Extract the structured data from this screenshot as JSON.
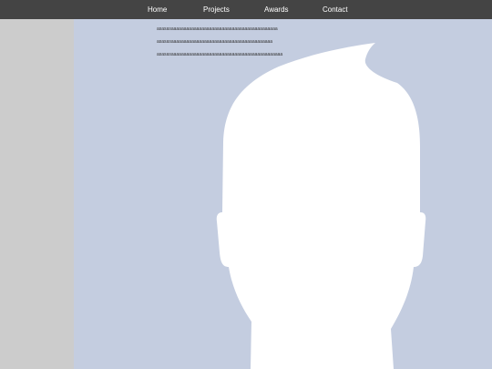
{
  "nav": {
    "items": [
      {
        "label": "Home"
      },
      {
        "label": "Projects"
      },
      {
        "label": "Awards"
      },
      {
        "label": "Contact"
      }
    ]
  },
  "main": {
    "text_lines": [
      "asasasaaaaaaaaaaaaaaaaaaaaaaaaaaaaaaaaaaaaaaaaaa",
      "asasasaaaaaaaaaaaaaaaaaaaaaaaaaaaaaaaaaaaaaaaa",
      "asasasaaaaaaaaaaaaaaaaaaaaaaaaaaaaaaaaaaaaaaaaaaaa"
    ],
    "avatar_icon": "default-profile-silhouette-icon"
  },
  "colors": {
    "nav_bg": "#444444",
    "sidebar_bg": "#cccccc",
    "main_bg": "#c4cde0",
    "silhouette": "#ffffff"
  }
}
